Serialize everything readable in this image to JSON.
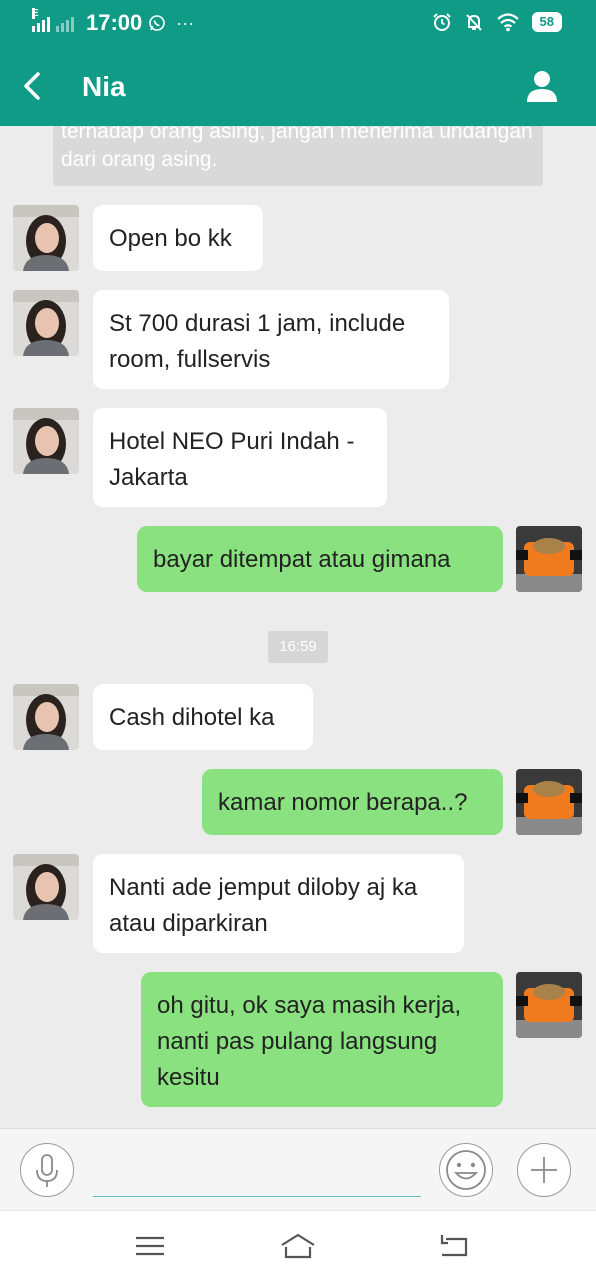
{
  "status_bar": {
    "network": "E",
    "time": "17:00",
    "extra": "···",
    "battery": "58",
    "icons": [
      "signal-icon",
      "whatsapp-icon",
      "alarm-icon",
      "bell-muted-icon",
      "wifi-icon",
      "battery-icon"
    ]
  },
  "header": {
    "contact_name": "Nia",
    "icons": [
      "back-arrow-icon",
      "profile-icon"
    ]
  },
  "colors": {
    "header": "#0f9b86",
    "chat_bg": "#ececec",
    "incoming_bubble": "#ffffff",
    "outgoing_bubble": "#89e27f"
  },
  "chat": {
    "system_notice": "terhadap orang asing, jangan menerima undangan dari orang asing.",
    "timestamp": "16:59",
    "messages": [
      {
        "direction": "in",
        "text": "Open bo kk"
      },
      {
        "direction": "in",
        "text": "St 700 durasi 1 jam, include room, fullservis"
      },
      {
        "direction": "in",
        "text": "Hotel NEO Puri Indah - Jakarta"
      },
      {
        "direction": "out",
        "text": "bayar ditempat atau gimana"
      },
      {
        "direction": "in",
        "text": "Cash dihotel ka"
      },
      {
        "direction": "out",
        "text": "kamar nomor berapa..?"
      },
      {
        "direction": "in",
        "text": "Nanti ade jemput diloby aj ka atau diparkiran"
      },
      {
        "direction": "out",
        "text": "oh gitu, ok saya masih kerja, nanti pas pulang langsung kesitu"
      }
    ]
  },
  "input_bar": {
    "value": "",
    "icons": [
      "microphone-icon",
      "emoji-icon",
      "plus-icon"
    ]
  },
  "nav_bar": {
    "icons": [
      "menu-icon",
      "home-icon",
      "back-icon"
    ]
  }
}
